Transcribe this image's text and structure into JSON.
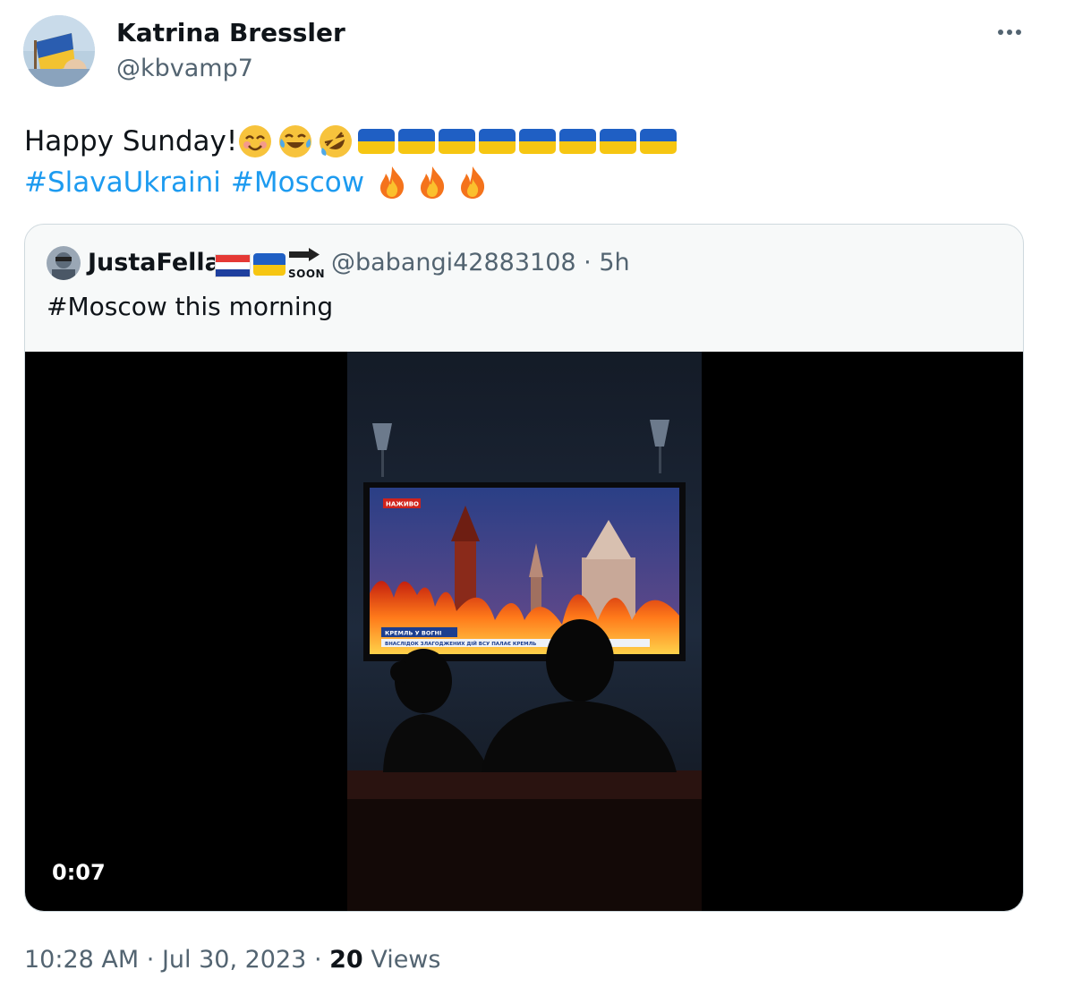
{
  "author": {
    "name": "Katrina Bressler",
    "handle": "@kbvamp7"
  },
  "tweet": {
    "text": "Happy Sunday!",
    "hashtags": [
      "#SlavaUkraini",
      "#Moscow"
    ],
    "emoji": [
      "smiling-face-icon",
      "tears-of-joy-icon",
      "rolling-laughing-icon",
      "ukraine-flag-icon",
      "fire-icon"
    ],
    "ukraine_flag_count": 8,
    "fire_count": 3
  },
  "quoted": {
    "name": "JustaFella",
    "soon_label": "SOON",
    "handle": "@babangi42883108",
    "separator": "·",
    "age": "5h",
    "text": "#Moscow this morning",
    "video": {
      "duration": "0:07",
      "screen_badge": "НАЖИВО",
      "screen_headline": "КРЕМЛЬ У ВОГНІ",
      "screen_ticker": "ВНАСЛІДОК ЗЛАГОДЖЕНИХ ДІЙ ВСУ ПАЛАЄ КРЕМЛЬ"
    }
  },
  "footer": {
    "time": "10:28 AM",
    "date": "Jul 30, 2023",
    "views_count": "20",
    "views_label": "Views"
  },
  "colors": {
    "link": "#1d9bf0",
    "secondary_text": "#536471",
    "border": "#cfd9de",
    "ukraine_blue": "#1f5fc4",
    "ukraine_yellow": "#f6c612"
  }
}
